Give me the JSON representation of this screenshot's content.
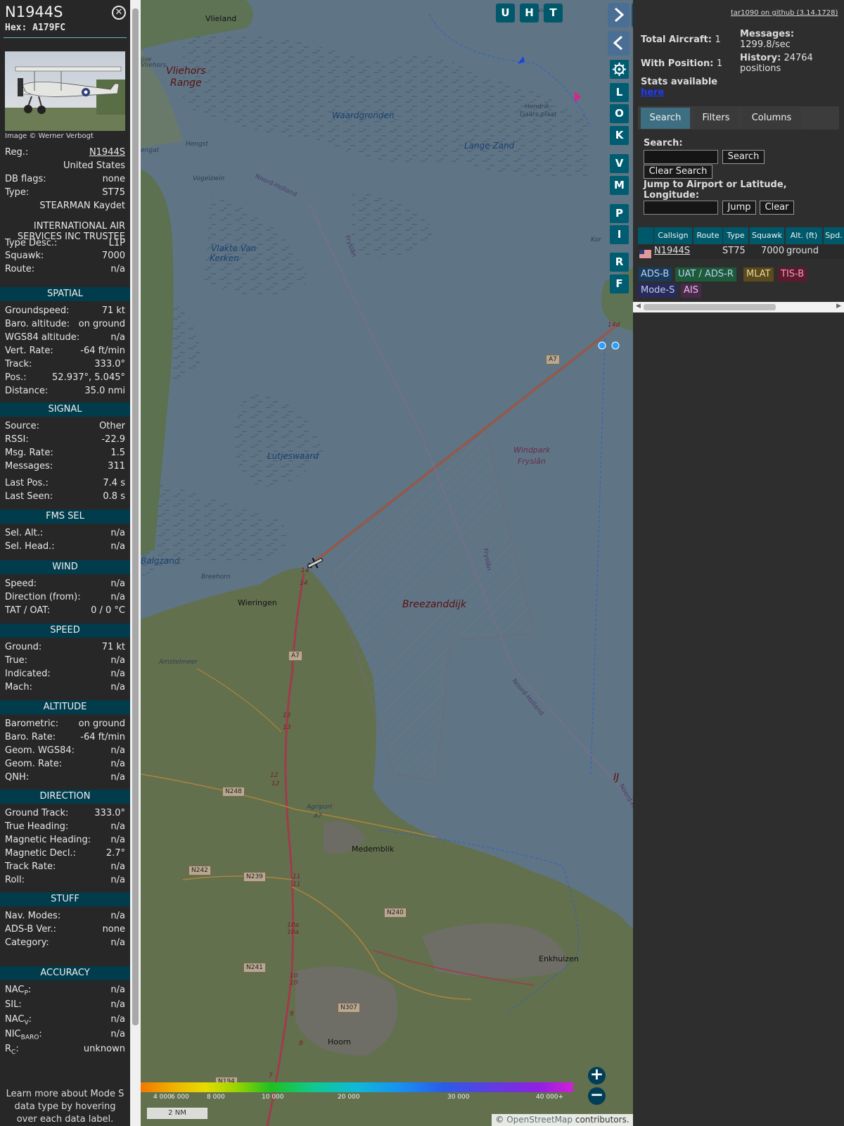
{
  "aircraft": {
    "callsign": "N1944S",
    "hex_label": "Hex:",
    "hex": "A179FC",
    "photo_credit": "Image © Werner Verbogt"
  },
  "details": [
    {
      "k": "Reg.:",
      "v": "N1944S"
    },
    {
      "full": "United States"
    },
    {
      "k": "DB flags:",
      "v": "none"
    },
    {
      "k": "Type:",
      "v": "ST75"
    },
    {
      "full": "STEARMAN Kaydet"
    },
    {
      "center": "INTERNATIONAL AIR SERVICES INC TRUSTEE"
    },
    {
      "k": "Type Desc.:",
      "v": "L1P"
    },
    {
      "k": "Squawk:",
      "v": "7000"
    },
    {
      "k": "Route:",
      "v": "n/a"
    }
  ],
  "sections": [
    {
      "title": "SPATIAL",
      "rows": [
        [
          "Groundspeed:",
          "71 kt"
        ],
        [
          "Baro. altitude:",
          "on ground"
        ],
        [
          "WGS84 altitude:",
          "n/a"
        ],
        [
          "Vert. Rate:",
          "-64 ft/min"
        ],
        [
          "Track:",
          "333.0°"
        ],
        [
          "Pos.:",
          "52.937°, 5.045°"
        ],
        [
          "Distance:",
          "35.0 nmi"
        ]
      ]
    },
    {
      "title": "SIGNAL",
      "rows": [
        [
          "Source:",
          "Other"
        ],
        [
          "RSSI:",
          "-22.9"
        ],
        [
          "Msg. Rate:",
          "1.5"
        ],
        [
          "Messages:",
          "311"
        ],
        [
          "Last Pos.:",
          "7.4 s"
        ],
        [
          "Last Seen:",
          "0.8 s"
        ]
      ]
    },
    {
      "title": "FMS SEL",
      "rows": [
        [
          "Sel. Alt.:",
          "n/a"
        ],
        [
          "Sel. Head.:",
          "n/a"
        ]
      ]
    },
    {
      "title": "WIND",
      "rows": [
        [
          "Speed:",
          "n/a"
        ],
        [
          "Direction (from):",
          "n/a"
        ],
        [
          "TAT / OAT:",
          "0 / 0 °C"
        ]
      ]
    },
    {
      "title": "SPEED",
      "rows": [
        [
          "Ground:",
          "71 kt"
        ],
        [
          "True:",
          "n/a"
        ],
        [
          "Indicated:",
          "n/a"
        ],
        [
          "Mach:",
          "n/a"
        ]
      ]
    },
    {
      "title": "ALTITUDE",
      "rows": [
        [
          "Barometric:",
          "on ground"
        ],
        [
          "Baro. Rate:",
          "-64 ft/min"
        ],
        [
          "Geom. WGS84:",
          "n/a"
        ],
        [
          "Geom. Rate:",
          "n/a"
        ],
        [
          "QNH:",
          "n/a"
        ]
      ]
    },
    {
      "title": "DIRECTION",
      "rows": [
        [
          "Ground Track:",
          "333.0°"
        ],
        [
          "True Heading:",
          "n/a"
        ],
        [
          "Magnetic Heading:",
          "n/a"
        ],
        [
          "Magnetic Decl.:",
          "2.7°"
        ],
        [
          "Track Rate:",
          "n/a"
        ],
        [
          "Roll:",
          "n/a"
        ]
      ]
    },
    {
      "title": "STUFF",
      "rows": [
        [
          "Nav. Modes:",
          "n/a"
        ],
        [
          "ADS-B Ver.:",
          "none"
        ],
        [
          "Category:",
          "n/a"
        ]
      ]
    },
    {
      "title": "ACCURACY",
      "rows": [
        [
          "NAC",
          "P",
          ":",
          "n/a"
        ],
        [
          "SIL:",
          "",
          "",
          "n/a"
        ],
        [
          "NAC",
          "V",
          ":",
          "n/a"
        ],
        [
          "NIC",
          "BARO",
          ":",
          "n/a"
        ],
        [
          "R",
          "C",
          ":",
          "unknown"
        ]
      ]
    }
  ],
  "footer_note": "Learn more about Mode S data type by hovering over each data label.",
  "map": {
    "labels": [
      {
        "t": "Vlieland",
        "s": "place"
      },
      {
        "t": "Vliehors",
        "s": "small"
      },
      {
        "t": "Vliehors",
        "s": "bold"
      },
      {
        "t": "Range",
        "s": "bold"
      },
      {
        "t": "Waardgronden",
        "s": "water"
      },
      {
        "t": "Hendrik-",
        "s": "small"
      },
      {
        "t": "Tjaars-plaat",
        "s": "small"
      },
      {
        "t": "Lange Zand",
        "s": "water"
      },
      {
        "t": "Hengst",
        "s": "small"
      },
      {
        "t": "Vogelzwin",
        "s": "small"
      },
      {
        "t": "Vlakte Van",
        "s": "water"
      },
      {
        "t": "Kerken",
        "s": "water"
      },
      {
        "t": "Lutjeswaard",
        "s": "water"
      },
      {
        "t": "Windpark",
        "s": "pink"
      },
      {
        "t": "Fryslân",
        "s": "pink"
      },
      {
        "t": "Balgzand",
        "s": "water"
      },
      {
        "t": "Breehorn",
        "s": "small"
      },
      {
        "t": "Wieringen",
        "s": "place"
      },
      {
        "t": "Breezanddijk",
        "s": "bold"
      },
      {
        "t": "Amstelmeer",
        "s": "small"
      },
      {
        "t": "Agriport",
        "s": "small"
      },
      {
        "t": "A7",
        "s": "small"
      },
      {
        "t": "Medemblik",
        "s": "place"
      },
      {
        "t": "Enkhuizen",
        "s": "place"
      },
      {
        "t": "Hoorn",
        "s": "place"
      },
      {
        "t": "Noord-Holland",
        "s": "border"
      },
      {
        "t": "Fryslân",
        "s": "border"
      },
      {
        "t": "Fryslân",
        "s": "border"
      },
      {
        "t": "Noord-Holland",
        "s": "border"
      },
      {
        "t": "Noord-Holland",
        "s": "border"
      },
      {
        "t": "IJ",
        "s": "bold"
      },
      {
        "t": "Kor",
        "s": "small"
      },
      {
        "t": "14",
        "s": "km"
      },
      {
        "t": "14",
        "s": "km"
      },
      {
        "t": "13",
        "s": "km"
      },
      {
        "t": "13",
        "s": "km"
      },
      {
        "t": "12",
        "s": "km"
      },
      {
        "t": "12",
        "s": "km"
      },
      {
        "t": "11",
        "s": "km"
      },
      {
        "t": "11",
        "s": "km"
      },
      {
        "t": "10a",
        "s": "km"
      },
      {
        "t": "10a",
        "s": "km"
      },
      {
        "t": "10",
        "s": "km"
      },
      {
        "t": "10",
        "s": "km"
      },
      {
        "t": "9",
        "s": "km"
      },
      {
        "t": "8",
        "s": "km"
      },
      {
        "t": "7",
        "s": "km"
      },
      {
        "t": "14d",
        "s": "km"
      },
      {
        "t": "ijvaar",
        "s": "small"
      },
      {
        "t": "engat",
        "s": "small"
      },
      {
        "t": "ijse",
        "s": "small"
      }
    ],
    "shields": [
      "A7",
      "A7",
      "N248",
      "N242",
      "N239",
      "N240",
      "N241",
      "N307",
      "N194"
    ],
    "top_buttons": [
      "U",
      "H",
      "T"
    ],
    "side_buttons": [
      "L",
      "O",
      "K",
      "V",
      "M",
      "P",
      "I",
      "R",
      "F"
    ],
    "altitude_legend": [
      "4 000",
      "6 000",
      "8 000",
      "10 000",
      "20 000",
      "30 000",
      "40 000+"
    ],
    "scale_label": "2 NM",
    "attribution_prefix": "© ",
    "attribution_link": "OpenStreetMap",
    "attribution_suffix": " contributors."
  },
  "right": {
    "github_link": "tar1090 on github (3.14.1728)",
    "total_label": "Total Aircraft:",
    "total_value": "1",
    "withpos_label": "With Position:",
    "withpos_value": "1",
    "messages_label": "Messages:",
    "messages_value": "1299.8/sec",
    "history_label": "History:",
    "history_value": "24764 positions",
    "stats_text": "Stats available",
    "stats_link": "here",
    "tabs": [
      "Search",
      "Filters",
      "Columns"
    ],
    "search_label": "Search:",
    "search_button": "Search",
    "clear_search_button": "Clear Search",
    "jump_label": "Jump to Airport or Latitude, Longitude:",
    "jump_button": "Jump",
    "clear_button": "Clear",
    "table_headers": [
      "",
      "Callsign",
      "Route",
      "Type",
      "Squawk",
      "Alt. (ft)",
      "Spd."
    ],
    "table_rows": [
      {
        "flag": "us-flag",
        "callsign": "N1944S",
        "route": "",
        "type": "ST75",
        "squawk": "7000",
        "alt": "ground",
        "spd": ""
      }
    ],
    "legend": [
      {
        "label": "ADS-B",
        "color": "#1a3a5c"
      },
      {
        "label": "UAT / ADS-R",
        "color": "#1d5a3a"
      },
      {
        "label": "MLAT",
        "color": "#5a4a1c"
      },
      {
        "label": "TIS-B",
        "color": "#5c1a2e"
      },
      {
        "label": "Mode-S",
        "color": "#2a2a5a"
      },
      {
        "label": "AIS",
        "color": "#4a2a4a"
      }
    ]
  },
  "colors": {
    "accent": "#00596b",
    "section": "#003c4c"
  }
}
